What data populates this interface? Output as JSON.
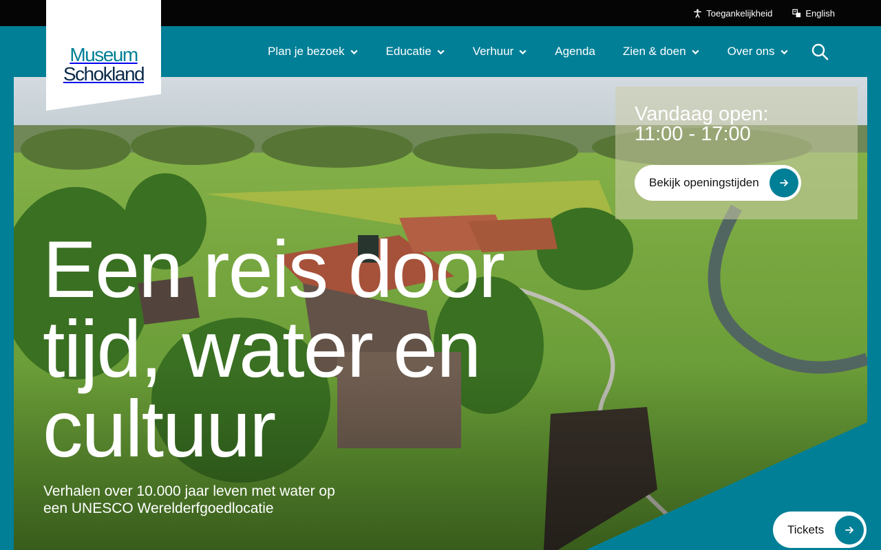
{
  "topbar": {
    "accessibility_label": "Toegankelijkheid",
    "language_label": "English"
  },
  "logo": {
    "line1": "Museum",
    "line2": "Schokland"
  },
  "nav": {
    "items": [
      {
        "label": "Plan je bezoek",
        "has_dropdown": true
      },
      {
        "label": "Educatie",
        "has_dropdown": true
      },
      {
        "label": "Verhuur",
        "has_dropdown": true
      },
      {
        "label": "Agenda",
        "has_dropdown": false
      },
      {
        "label": "Zien & doen",
        "has_dropdown": true
      },
      {
        "label": "Over ons",
        "has_dropdown": true
      }
    ],
    "search_icon": "search-icon"
  },
  "hero": {
    "headline_line1": "Een reis door",
    "headline_line2": "tijd, water en",
    "headline_line3": "cultuur",
    "subline_line1": "Verhalen over 10.000 jaar leven met water op",
    "subline_line2": "een UNESCO Werelderfgoedlocatie"
  },
  "opening": {
    "title_line1": "Vandaag open:",
    "title_line2": "11:00 - 17:00",
    "button_label": "Bekijk openingstijden"
  },
  "tickets": {
    "label": "Tickets"
  },
  "colors": {
    "brand_teal": "#007f96",
    "topbar_black": "#050505",
    "logo_navy": "#0b2a4a"
  }
}
